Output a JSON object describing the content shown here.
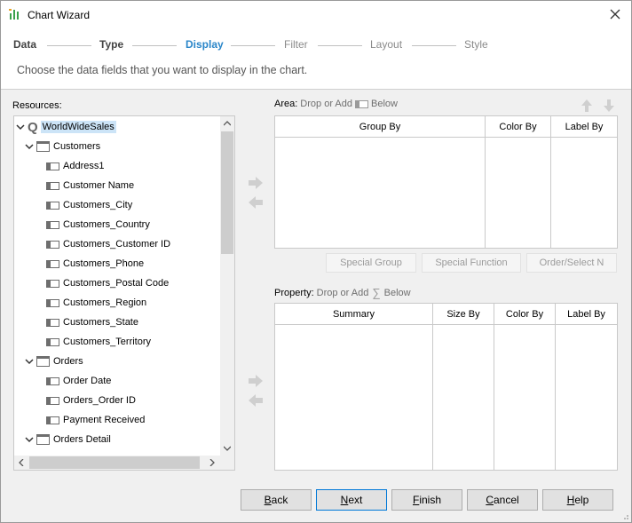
{
  "window": {
    "title": "Chart Wizard"
  },
  "steps": [
    {
      "label": "Data"
    },
    {
      "label": "Type"
    },
    {
      "label": "Display"
    },
    {
      "label": "Filter"
    },
    {
      "label": "Layout"
    },
    {
      "label": "Style"
    }
  ],
  "instruction": "Choose the data fields that you want to display in the chart.",
  "resources": {
    "label": "Resources:",
    "root": "WorldWideSales",
    "nodes": [
      {
        "label": "Customers",
        "kind": "table"
      },
      {
        "label": "Address1",
        "kind": "field"
      },
      {
        "label": "Customer Name",
        "kind": "field"
      },
      {
        "label": "Customers_City",
        "kind": "field"
      },
      {
        "label": "Customers_Country",
        "kind": "field"
      },
      {
        "label": "Customers_Customer ID",
        "kind": "field"
      },
      {
        "label": "Customers_Phone",
        "kind": "field"
      },
      {
        "label": "Customers_Postal Code",
        "kind": "field"
      },
      {
        "label": "Customers_Region",
        "kind": "field"
      },
      {
        "label": "Customers_State",
        "kind": "field"
      },
      {
        "label": "Customers_Territory",
        "kind": "field"
      },
      {
        "label": "Orders",
        "kind": "table"
      },
      {
        "label": "Order Date",
        "kind": "field"
      },
      {
        "label": "Orders_Order ID",
        "kind": "field"
      },
      {
        "label": "Payment Received",
        "kind": "field"
      },
      {
        "label": "Orders Detail",
        "kind": "table"
      }
    ]
  },
  "area": {
    "label": "Area:",
    "hint_pre": "Drop or Add",
    "hint_post": "Below",
    "columns": [
      "Group By",
      "Color By",
      "Label By"
    ],
    "buttons": [
      "Special Group",
      "Special Function",
      "Order/Select N"
    ]
  },
  "property": {
    "label": "Property:",
    "hint_pre": "Drop or Add",
    "hint_post": "Below",
    "columns": [
      "Summary",
      "Size By",
      "Color By",
      "Label By"
    ]
  },
  "footer": {
    "back": {
      "pre": "",
      "u": "B",
      "post": "ack"
    },
    "next": {
      "pre": "",
      "u": "N",
      "post": "ext"
    },
    "finish": {
      "pre": "",
      "u": "F",
      "post": "inish"
    },
    "cancel": {
      "pre": "",
      "u": "C",
      "post": "ancel"
    },
    "help": {
      "pre": "",
      "u": "H",
      "post": "elp"
    }
  },
  "colors": {
    "accent": "#2a86c9",
    "primary_border": "#0078d7"
  }
}
